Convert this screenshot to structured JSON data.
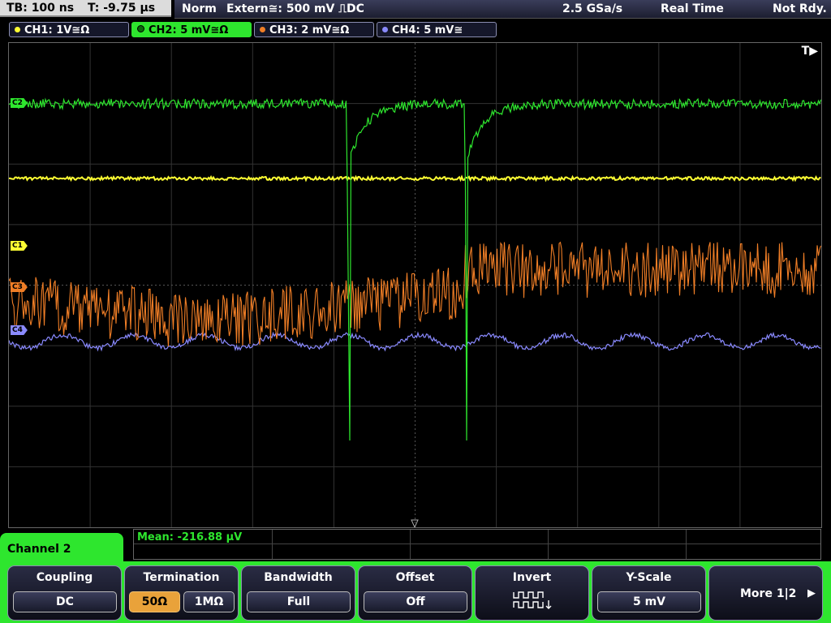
{
  "top": {
    "timebase": "TB: 100 ns",
    "trigger_time": "T: -9.75 µs",
    "mode": "Norm",
    "trigger_source": "Extern≅: 500 mV ⎍DC",
    "sample_rate": "2.5 GSa/s",
    "acq_mode": "Real Time",
    "status": "Not Rdy."
  },
  "channels": [
    {
      "label": "CH1: 1V≅Ω",
      "color": "#ffff33"
    },
    {
      "label": "CH2: 5 mV≅Ω",
      "color": "#2ee62e"
    },
    {
      "label": "CH3: 2 mV≅Ω",
      "color": "#f07e26"
    },
    {
      "label": "CH4: 5 mV≅",
      "color": "#8a8aff"
    }
  ],
  "markers": {
    "c1": "C1",
    "c3": "C3",
    "c4": "C4",
    "c2": "C2",
    "trigger": "T"
  },
  "measurement": {
    "text": "Mean: -216.88 µV"
  },
  "panel": {
    "title": "Channel 2"
  },
  "softkeys": {
    "coupling": {
      "title": "Coupling",
      "value": "DC"
    },
    "termination": {
      "title": "Termination",
      "opt1": "50Ω",
      "opt2": "1MΩ"
    },
    "bandwidth": {
      "title": "Bandwidth",
      "value": "Full"
    },
    "offset": {
      "title": "Offset",
      "value": "Off"
    },
    "invert": {
      "title": "Invert"
    },
    "yscale": {
      "title": "Y-Scale",
      "value": "5 mV"
    },
    "more": {
      "label": "More 1|2"
    }
  }
}
